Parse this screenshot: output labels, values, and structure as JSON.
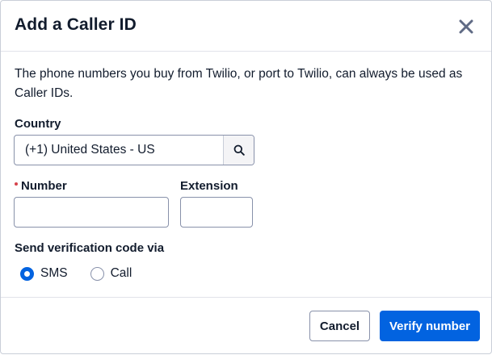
{
  "dialog": {
    "title": "Add a Caller ID",
    "description": "The phone numbers you buy from Twilio, or port to Twilio, can always be used as Caller IDs."
  },
  "country": {
    "label": "Country",
    "value": "(+1) United States - US"
  },
  "number": {
    "label": "Number",
    "value": "",
    "required": true
  },
  "extension": {
    "label": "Extension",
    "value": ""
  },
  "verification": {
    "label": "Send verification code via",
    "options": [
      {
        "label": "SMS",
        "checked": true
      },
      {
        "label": "Call",
        "checked": false
      }
    ]
  },
  "footer": {
    "cancel_label": "Cancel",
    "verify_label": "Verify number"
  },
  "colors": {
    "primary": "#0263e0",
    "text": "#121c2d",
    "required": "#d6434b"
  }
}
